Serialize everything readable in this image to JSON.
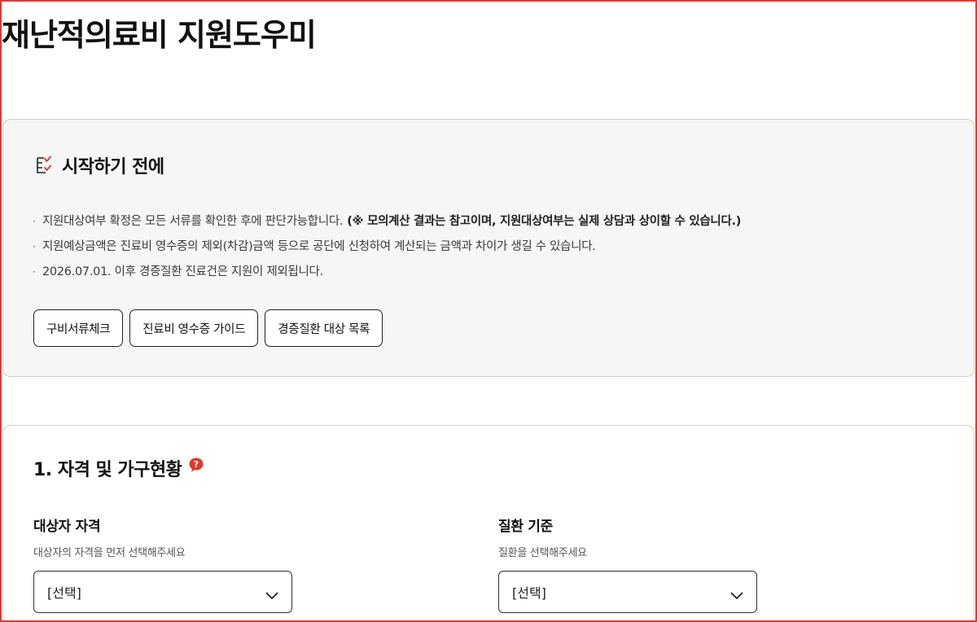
{
  "page": {
    "title": "재난적의료비 지원도우미"
  },
  "notice": {
    "title": "시작하기 전에",
    "icon": "checklist-icon",
    "items": [
      {
        "text": "지원대상여부 확정은 모든 서류를 확인한 후에 판단가능합니다.",
        "emphasis": "(※ 모의계산 결과는 참고이며, 지원대상여부는 실제 상담과 상이할 수 있습니다.)"
      },
      {
        "text": "지원예상금액은 진료비 영수증의 제외(차감)금액 등으로 공단에 신청하여 계산되는 금액과 차이가 생길 수 있습니다.",
        "emphasis": ""
      },
      {
        "text": "2026.07.01. 이후 경증질환 진료건은 지원이 제외됩니다.",
        "emphasis": ""
      }
    ],
    "buttons": [
      "구비서류체크",
      "진료비 영수증 가이드",
      "경증질환 대상 목록"
    ]
  },
  "section1": {
    "title": "1. 자격 및 가구현황",
    "help_icon": "question-bubble-icon",
    "fields": [
      {
        "label": "대상자 자격",
        "help": "대상자의 자격을 먼저 선택해주세요",
        "value": "[선택]"
      },
      {
        "label": "질환 기준",
        "help": "질환을 선택해주세요",
        "value": "[선택]"
      }
    ]
  },
  "colors": {
    "accent": "#e0392f",
    "panel_bg": "#f6f6f6",
    "border": "#cfcfcf",
    "text": "#111111"
  }
}
